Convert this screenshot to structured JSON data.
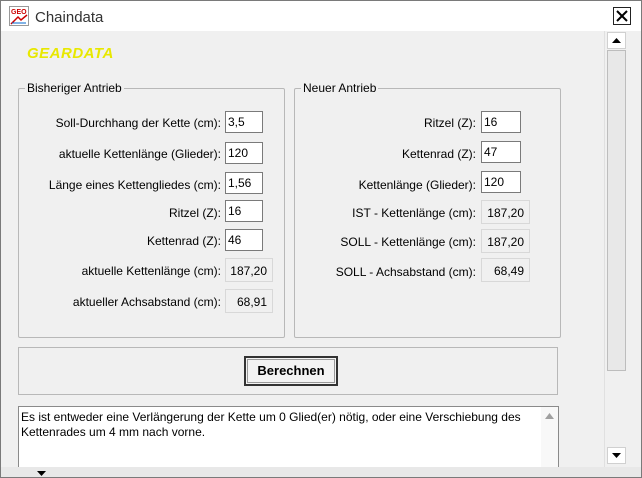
{
  "window": {
    "title": "Chaindata",
    "logo_text": "GEARDATA",
    "app_icon": "geo-app-icon",
    "close_icon": "close-icon"
  },
  "left_group": {
    "legend": "Bisheriger Antrieb",
    "fields": [
      {
        "label": "Soll-Durchhang der Kette (cm):",
        "value": "3,5"
      },
      {
        "label": "aktuelle Kettenlänge (Glieder):",
        "value": "120"
      },
      {
        "label": "Länge eines Kettengliedes (cm):",
        "value": "1,56"
      },
      {
        "label": "Ritzel (Z):",
        "value": "16"
      },
      {
        "label": "Kettenrad (Z):",
        "value": "46"
      }
    ],
    "results": [
      {
        "label": "aktuelle Kettenlänge (cm):",
        "value": "187,20"
      },
      {
        "label": "aktueller Achsabstand (cm):",
        "value": "68,91"
      }
    ]
  },
  "right_group": {
    "legend": "Neuer Antrieb",
    "fields": [
      {
        "label": "Ritzel (Z):",
        "value": "16"
      },
      {
        "label": "Kettenrad (Z):",
        "value": "47"
      },
      {
        "label": "Kettenlänge (Glieder):",
        "value": "120"
      }
    ],
    "results": [
      {
        "label": "IST - Kettenlänge (cm):",
        "value": "187,20"
      },
      {
        "label": "SOLL - Kettenlänge (cm):",
        "value": "187,20"
      },
      {
        "label": "SOLL - Achsabstand (cm):",
        "value": "68,49"
      }
    ]
  },
  "calculate_button": "Berechnen",
  "message": "Es ist entweder eine Verlängerung der Kette um 0 Glied(er) nötig, oder eine Verschiebung des Kettenrades um 4 mm nach vorne.",
  "colors": {
    "logo": "#e8e800",
    "background": "#f0f0f0"
  }
}
